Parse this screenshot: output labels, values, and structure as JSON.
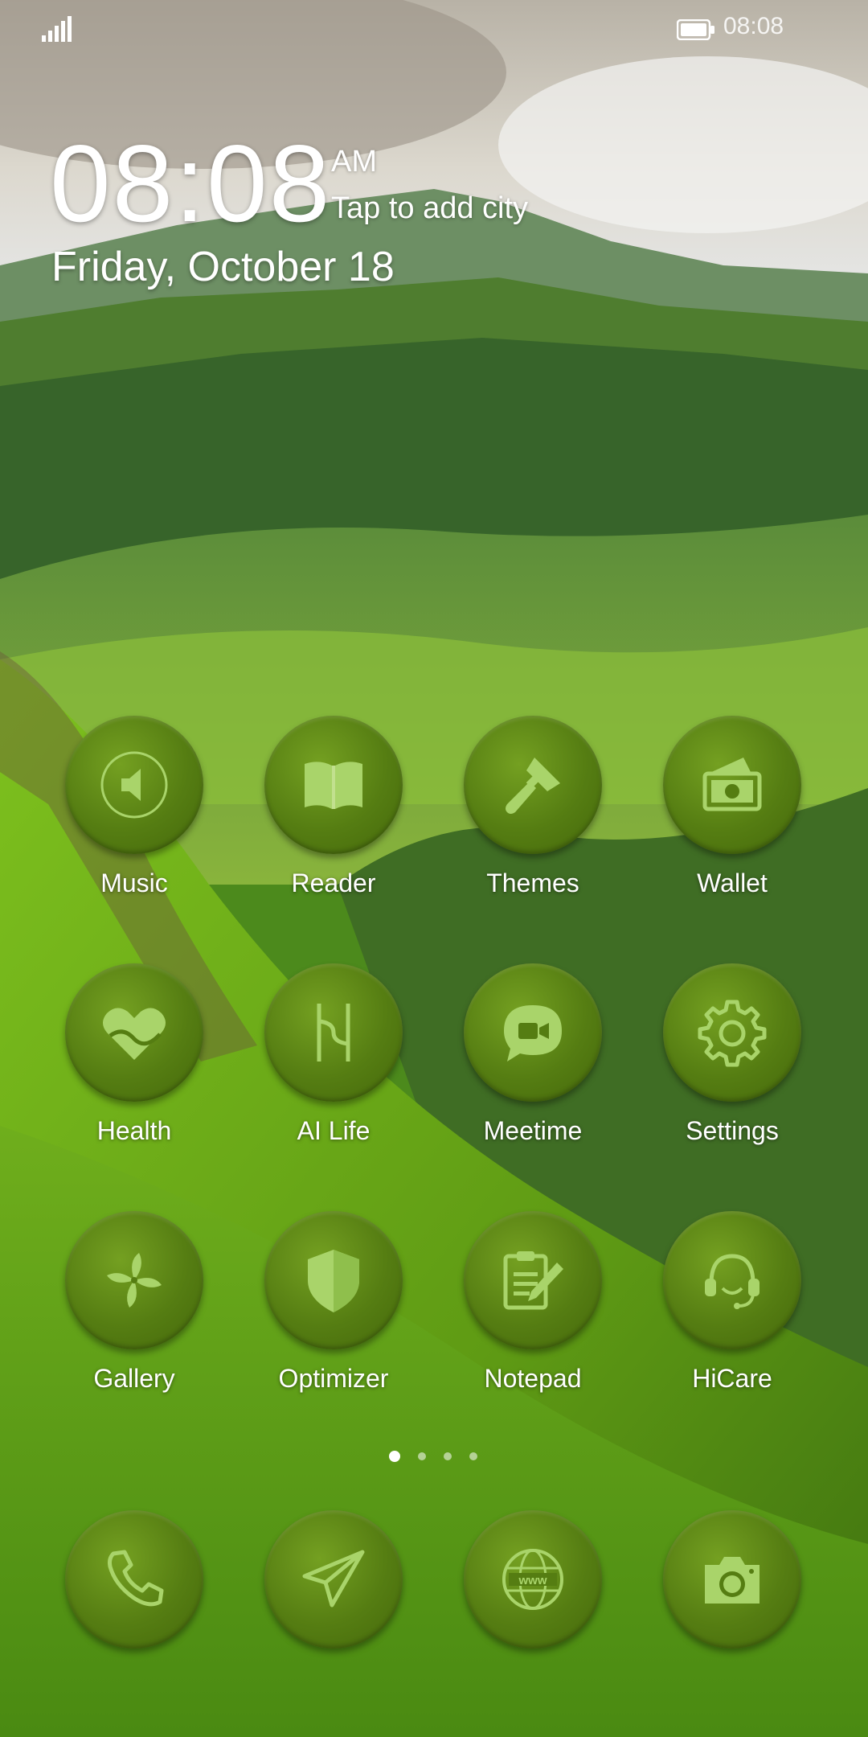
{
  "status_bar": {
    "time": "08:08",
    "signal_icon": "signal-icon",
    "battery_icon": "battery-icon"
  },
  "clock_widget": {
    "time": "08:08",
    "ampm": "AM",
    "city": "Tap to add city",
    "date": "Friday, October 18"
  },
  "apps": [
    {
      "label": "Music",
      "icon": "speaker-icon"
    },
    {
      "label": "Reader",
      "icon": "book-icon"
    },
    {
      "label": "Themes",
      "icon": "paintbrush-icon"
    },
    {
      "label": "Wallet",
      "icon": "wallet-icon"
    },
    {
      "label": "Health",
      "icon": "heart-icon"
    },
    {
      "label": "AI Life",
      "icon": "ai-life-icon"
    },
    {
      "label": "Meetime",
      "icon": "video-chat-icon"
    },
    {
      "label": "Settings",
      "icon": "gear-icon"
    },
    {
      "label": "Gallery",
      "icon": "pinwheel-icon"
    },
    {
      "label": "Optimizer",
      "icon": "shield-icon"
    },
    {
      "label": "Notepad",
      "icon": "notepad-icon"
    },
    {
      "label": "HiCare",
      "icon": "headset-icon"
    }
  ],
  "dock": [
    {
      "icon": "phone-icon"
    },
    {
      "icon": "paper-plane-icon"
    },
    {
      "icon": "globe-icon",
      "text": "www"
    },
    {
      "icon": "camera-icon"
    }
  ],
  "page_indicator": {
    "pages": 4,
    "current": 1
  },
  "colors": {
    "icon_bg": "#557d12",
    "icon_glyph": "#a9d46a",
    "text": "#ffffff"
  }
}
